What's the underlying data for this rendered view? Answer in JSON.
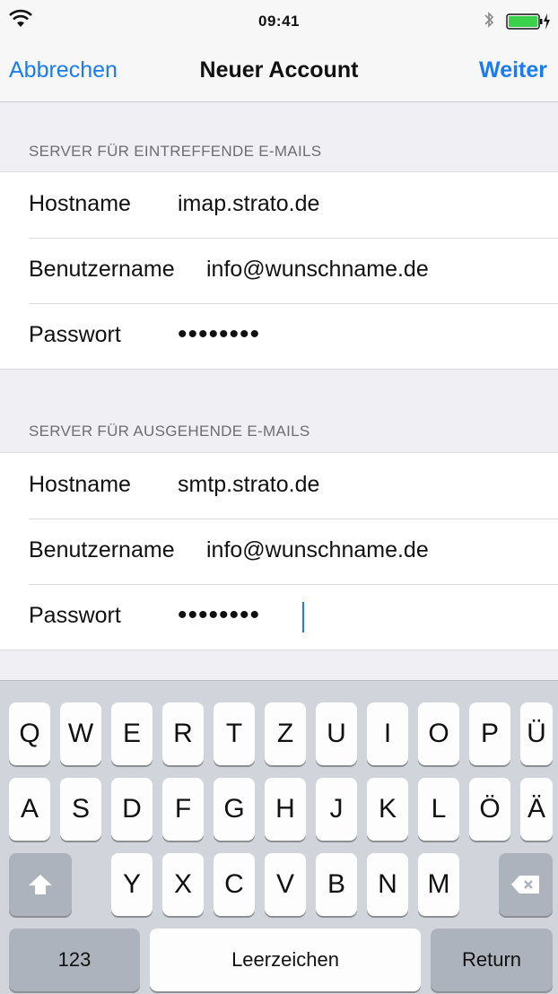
{
  "status_bar": {
    "time": "09:41",
    "icons": [
      "wifi-icon",
      "bluetooth-icon",
      "battery-charging-icon"
    ]
  },
  "nav": {
    "cancel": "Abbrechen",
    "title": "Neuer Account",
    "next": "Weiter"
  },
  "incoming": {
    "header": "SERVER FÜR EINTREFFENDE E-MAILS",
    "rows": [
      {
        "label": "Hostname",
        "value": "imap.strato.de"
      },
      {
        "label": "Benutzername",
        "value": "info@wunschname.de"
      },
      {
        "label": "Passwort",
        "value": "••••••••"
      }
    ]
  },
  "outgoing": {
    "header": "SERVER FÜR AUSGEHENDE E-MAILS",
    "rows": [
      {
        "label": "Hostname",
        "value": "smtp.strato.de"
      },
      {
        "label": "Benutzername",
        "value": "info@wunschname.de"
      },
      {
        "label": "Passwort",
        "value": "••••••••"
      }
    ]
  },
  "keyboard": {
    "row1": [
      "Q",
      "W",
      "E",
      "R",
      "T",
      "Z",
      "U",
      "I",
      "O",
      "P",
      "Ü"
    ],
    "row2": [
      "A",
      "S",
      "D",
      "F",
      "G",
      "H",
      "J",
      "K",
      "L",
      "Ö",
      "Ä"
    ],
    "row3": [
      "Y",
      "X",
      "C",
      "V",
      "B",
      "N",
      "M"
    ],
    "numbers": "123",
    "space": "Leerzeichen",
    "return": "Return",
    "shift_icon": "shift-icon",
    "delete_icon": "delete-icon"
  },
  "colors": {
    "accent": "#1a7cf5",
    "background": "#efeff4",
    "keyboard": "#d1d5db"
  }
}
